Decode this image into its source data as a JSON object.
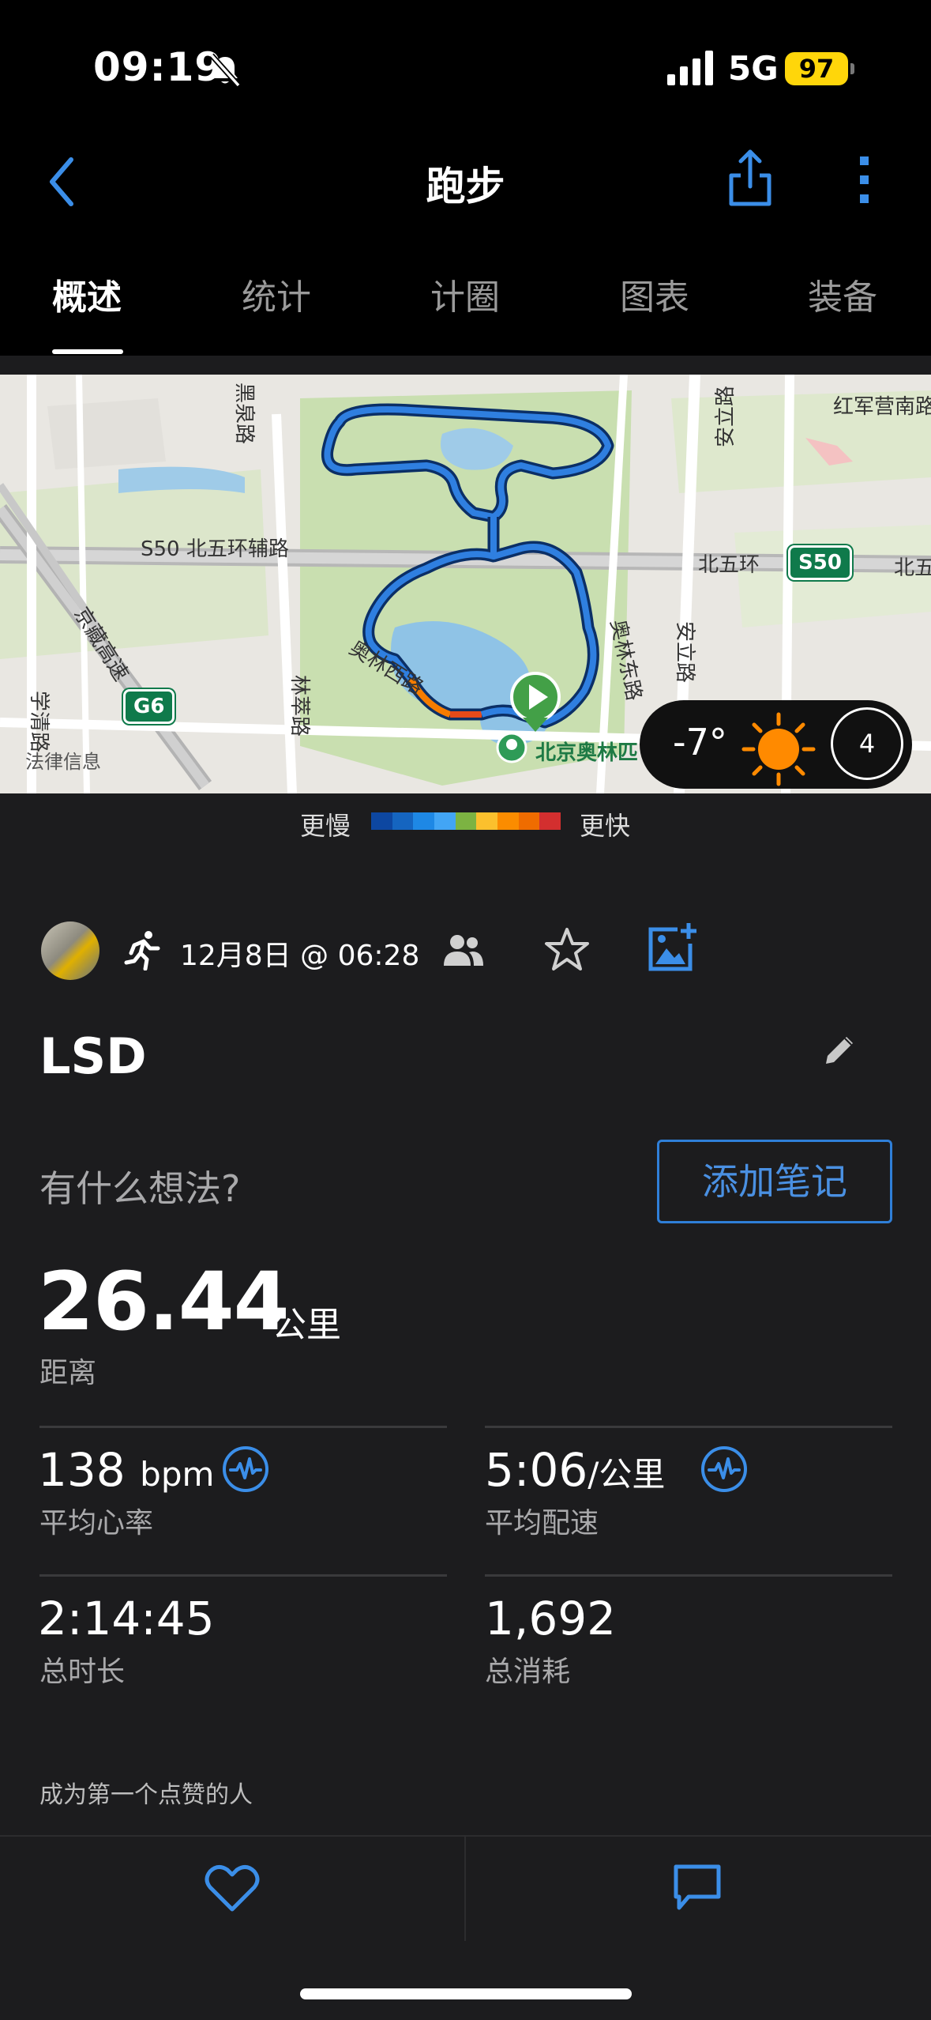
{
  "status_bar": {
    "time": "09:19",
    "network": "5G",
    "battery": "97"
  },
  "nav": {
    "title": "跑步"
  },
  "tabs": [
    {
      "label": "概述",
      "active": true
    },
    {
      "label": "统计",
      "active": false
    },
    {
      "label": "计圈",
      "active": false
    },
    {
      "label": "图表",
      "active": false
    },
    {
      "label": "装备",
      "active": false
    }
  ],
  "map": {
    "labels": {
      "heiquan_road": "黑泉路",
      "hongjunying": "红军营南路",
      "s50_aux": "S50 北五环辅路",
      "beiwuhuan": "北五环",
      "beiwu_right": "北五",
      "jingzang": "京藏高速",
      "xueqing": "学清路",
      "linfeng": "林萃路",
      "aolin_west": "奥林西路",
      "aolin_east": "奥林东路",
      "anli": "安立路",
      "anli_top": "安立路",
      "park": "北京奥林匹",
      "legal": "法律信息"
    },
    "badges": {
      "s50": "S50",
      "g6": "G6"
    },
    "weather": {
      "temp": "-7°",
      "wind": "4",
      "icon": "sun-icon"
    }
  },
  "legend": {
    "slow": "更慢",
    "fast": "更快",
    "colors": [
      "#0d47a1",
      "#1565c0",
      "#1e88e5",
      "#42a5f5",
      "#7cb342",
      "#fbc02d",
      "#fb8c00",
      "#ef6c00",
      "#d32f2f"
    ]
  },
  "activity": {
    "date": "12月8日 @ 06:28",
    "title": "LSD",
    "thoughts_placeholder": "有什么想法?",
    "add_note": "添加笔记",
    "distance": {
      "value": "26.44",
      "unit": "公里",
      "label": "距离"
    },
    "stats": [
      {
        "value": "138",
        "unit": "bpm",
        "label": "平均心率"
      },
      {
        "value": "5:06",
        "unit": "/公里",
        "label": "平均配速"
      },
      {
        "value": "2:14:45",
        "unit": "",
        "label": "总时长"
      },
      {
        "value": "1,692",
        "unit": "",
        "label": "总消耗"
      }
    ],
    "like_prompt": "成为第一个点赞的人"
  },
  "colors": {
    "accent": "#4a90e2",
    "background": "#1c1c1e",
    "route": "#1f6fd1"
  }
}
